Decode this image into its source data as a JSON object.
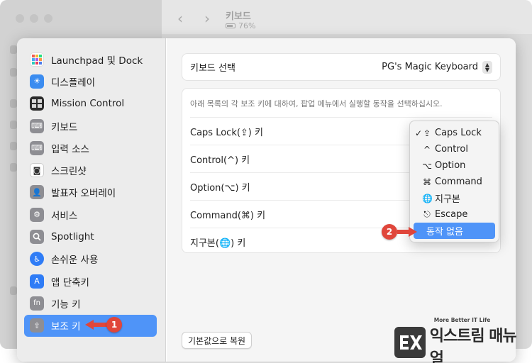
{
  "background": {
    "window_title": "키보드",
    "battery": "76%"
  },
  "sidebar": {
    "items": [
      {
        "label": "Launchpad 및 Dock",
        "icon": "launchpad-icon",
        "color": "#f5f5f5"
      },
      {
        "label": "디스플레이",
        "icon": "display-icon",
        "color": "#3b8cf0"
      },
      {
        "label": "Mission Control",
        "icon": "mission-control-icon",
        "color": "#2b2b2b"
      },
      {
        "label": "키보드",
        "icon": "keyboard-icon",
        "color": "#8e8e93"
      },
      {
        "label": "입력 소스",
        "icon": "input-source-icon",
        "color": "#8e8e93"
      },
      {
        "label": "스크린샷",
        "icon": "screenshot-icon",
        "color": "#f5f5f5"
      },
      {
        "label": "발표자 오버레이",
        "icon": "presenter-overlay-icon",
        "color": "#8e8e93"
      },
      {
        "label": "서비스",
        "icon": "services-icon",
        "color": "#8e8e93"
      },
      {
        "label": "Spotlight",
        "icon": "spotlight-icon",
        "color": "#8e8e93"
      },
      {
        "label": "손쉬운 사용",
        "icon": "accessibility-icon",
        "color": "#2f7cf6"
      },
      {
        "label": "앱 단축키",
        "icon": "app-shortcuts-icon",
        "color": "#2f7cf6"
      },
      {
        "label": "기능 키",
        "icon": "function-key-icon",
        "color": "#8e8e93"
      },
      {
        "label": "보조 키",
        "icon": "modifier-keys-icon",
        "color": "#8e8e93"
      }
    ],
    "selected_index": 12
  },
  "main": {
    "keyboard_select_label": "키보드 선택",
    "keyboard_select_value": "PG's Magic Keyboard",
    "description": "아래 목록의 각 보조 키에 대하여, 팝업 메뉴에서 실행할 동작을 선택하십시오.",
    "modifier_rows": [
      {
        "label": "Caps Lock(⇪) 키"
      },
      {
        "label": "Control(^) 키"
      },
      {
        "label": "Option(⌥) 키"
      },
      {
        "label": "Command(⌘) 키"
      },
      {
        "label": "지구본(🌐) 키"
      }
    ],
    "reset_button": "기본값으로 복원"
  },
  "popup_menu": {
    "items": [
      {
        "icon": "⇪",
        "label": "Caps Lock",
        "checked": true
      },
      {
        "icon": "^",
        "label": "Control",
        "checked": false
      },
      {
        "icon": "⌥",
        "label": "Option",
        "checked": false
      },
      {
        "icon": "⌘",
        "label": "Command",
        "checked": false
      },
      {
        "icon": "🌐",
        "label": "지구본",
        "checked": false
      },
      {
        "icon": "⎋",
        "label": "Escape",
        "checked": false
      },
      {
        "icon": "",
        "label": "동작 없음",
        "checked": false,
        "highlighted": true
      }
    ],
    "checkmark": "✓"
  },
  "annotations": {
    "badge1": "1",
    "badge2": "2",
    "color": "#e0463b"
  },
  "watermark": {
    "tagline": "More Better IT Life",
    "name": "익스트림 매뉴얼"
  },
  "colors": {
    "accent": "#4f94f8"
  }
}
